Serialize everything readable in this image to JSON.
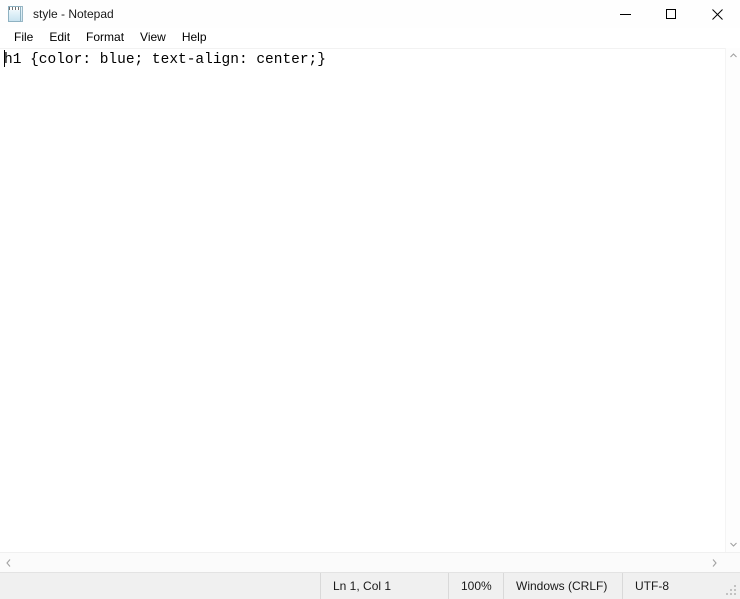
{
  "window": {
    "title": "style - Notepad",
    "icon": "notepad-icon",
    "controls": {
      "minimize": "minimize-icon",
      "maximize": "maximize-icon",
      "close": "close-icon"
    }
  },
  "menubar": {
    "items": [
      {
        "label": "File"
      },
      {
        "label": "Edit"
      },
      {
        "label": "Format"
      },
      {
        "label": "View"
      },
      {
        "label": "Help"
      }
    ]
  },
  "editor": {
    "content": "h1 {color: blue; text-align: center;}",
    "caret_line": 1,
    "caret_column": 1
  },
  "scrollbars": {
    "vertical": {
      "up_arrow": "chevron-up-icon",
      "down_arrow": "chevron-down-icon"
    },
    "horizontal": {
      "left_arrow": "chevron-left-icon",
      "right_arrow": "chevron-right-icon"
    }
  },
  "statusbar": {
    "cursor_position": "Ln 1, Col 1",
    "zoom": "100%",
    "line_ending": "Windows (CRLF)",
    "encoding": "UTF-8"
  },
  "colors": {
    "titlebar_bg": "#fefefe",
    "window_bg": "#ffffff",
    "statusbar_bg": "#f0f0f0",
    "text_fg": "#000000",
    "close_hover": "#e81123"
  }
}
